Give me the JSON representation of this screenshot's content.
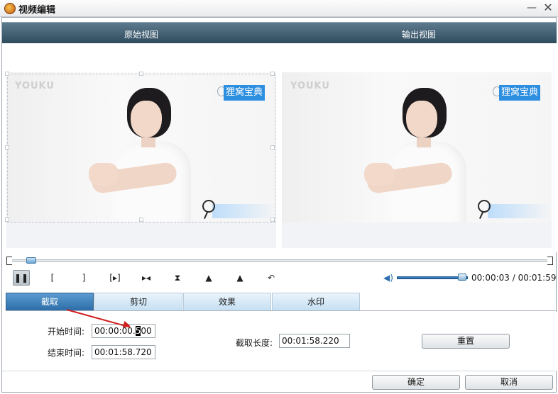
{
  "window": {
    "title": "视频编辑",
    "minimize_glyph": "—",
    "close_glyph": "✕"
  },
  "views": {
    "original_label": "原始视图",
    "output_label": "输出视图",
    "video_watermark": "YOUKU",
    "video_badge": "狸窝宝典"
  },
  "playback": {
    "time_readout": "00:00:03 / 00:01:59",
    "position_fraction": 0.025,
    "volume_fraction": 0.92,
    "buttons": {
      "pause": "❚❚",
      "mark_in": "[",
      "mark_out": "]",
      "play_range": "[▸]",
      "skip": "▸◂",
      "flip_vertical": "⧗",
      "rotate_left": "▲",
      "rotate_right": "▲",
      "undo": "↶"
    }
  },
  "tabs": [
    {
      "label": "截取"
    },
    {
      "label": "剪切"
    },
    {
      "label": "效果"
    },
    {
      "label": "水印"
    }
  ],
  "trim": {
    "start_label": "开始时间:",
    "start_value_before": "00:00:00.",
    "start_value_cursor": "5",
    "start_value_after": "00",
    "end_label": "结束时间:",
    "end_value": "00:01:58.720",
    "length_label": "截取长度:",
    "length_value": "00:01:58.220",
    "reset_label": "重置"
  },
  "footer": {
    "ok_label": "确定",
    "cancel_label": "取消"
  },
  "colors": {
    "accent": "#2d6ea8",
    "annotation_arrow": "#d02020",
    "header_bar": "#2f4b5e"
  }
}
